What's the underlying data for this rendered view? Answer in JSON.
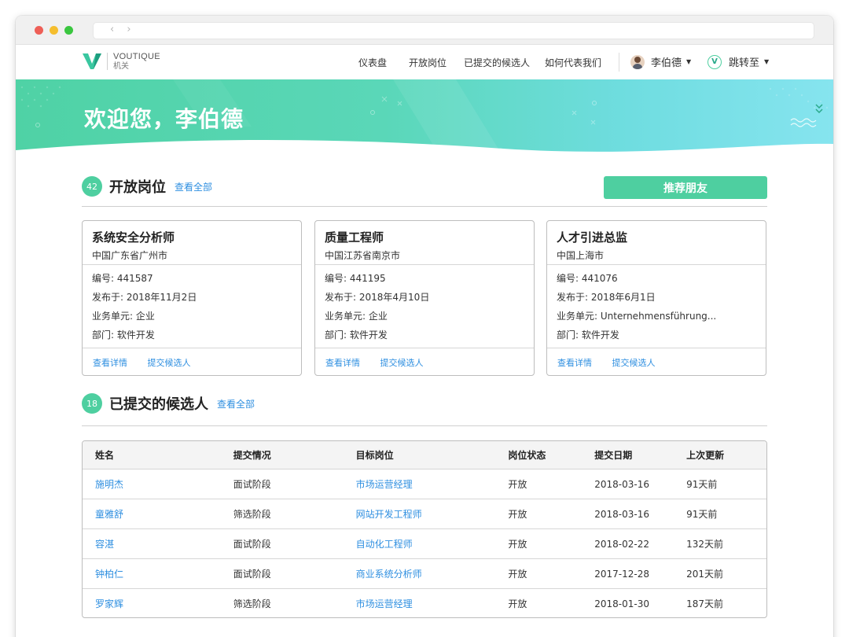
{
  "nav": {
    "logo_line1": "VOUTIQUE",
    "logo_line2": "机关",
    "items": [
      "仪表盘",
      "开放岗位",
      "已提交的候选人",
      "如何代表我们"
    ],
    "user_name": "李伯德",
    "jump_label": "跳转至"
  },
  "hero": {
    "greeting": "欢迎您，李伯德"
  },
  "open_jobs": {
    "count": "42",
    "title": "开放岗位",
    "view_all": "查看全部",
    "refer_button": "推荐朋友",
    "cards": [
      {
        "title": "系统安全分析师",
        "location": "中国广东省广州市",
        "id_label": "编号:",
        "id": "441587",
        "date_label": "发布于:",
        "date": "2018年11月2日",
        "unit_label": "业务单元:",
        "unit": "企业",
        "dept_label": "部门:",
        "dept": "软件开发",
        "details_link": "查看详情",
        "submit_link": "提交候选人"
      },
      {
        "title": "质量工程师",
        "location": "中国江苏省南京市",
        "id_label": "编号:",
        "id": "441195",
        "date_label": "发布于:",
        "date": "2018年4月10日",
        "unit_label": "业务单元:",
        "unit": "企业",
        "dept_label": "部门:",
        "dept": "软件开发",
        "details_link": "查看详情",
        "submit_link": "提交候选人"
      },
      {
        "title": "人才引进总监",
        "location": "中国上海市",
        "id_label": "编号:",
        "id": "441076",
        "date_label": "发布于:",
        "date": "2018年6月1日",
        "unit_label": "业务单元:",
        "unit": "Unternehmensführung...",
        "dept_label": "部门:",
        "dept": "软件开发",
        "details_link": "查看详情",
        "submit_link": "提交候选人"
      }
    ]
  },
  "candidates": {
    "count": "18",
    "title": "已提交的候选人",
    "view_all": "查看全部",
    "columns": [
      "姓名",
      "提交情况",
      "目标岗位",
      "岗位状态",
      "提交日期",
      "上次更新"
    ],
    "rows": [
      [
        "施明杰",
        "面试阶段",
        "市场运营经理",
        "开放",
        "2018-03-16",
        "91天前"
      ],
      [
        "童雅舒",
        "筛选阶段",
        "网站开发工程师",
        "开放",
        "2018-03-16",
        "91天前"
      ],
      [
        "容湛",
        "面试阶段",
        "自动化工程师",
        "开放",
        "2018-02-22",
        "132天前"
      ],
      [
        "钟柏仁",
        "面试阶段",
        "商业系统分析师",
        "开放",
        "2017-12-28",
        "201天前"
      ],
      [
        "罗家辉",
        "筛选阶段",
        "市场运营经理",
        "开放",
        "2018-01-30",
        "187天前"
      ]
    ]
  },
  "colors": {
    "accent": "#4ecfa0",
    "link": "#2f8fe0"
  }
}
